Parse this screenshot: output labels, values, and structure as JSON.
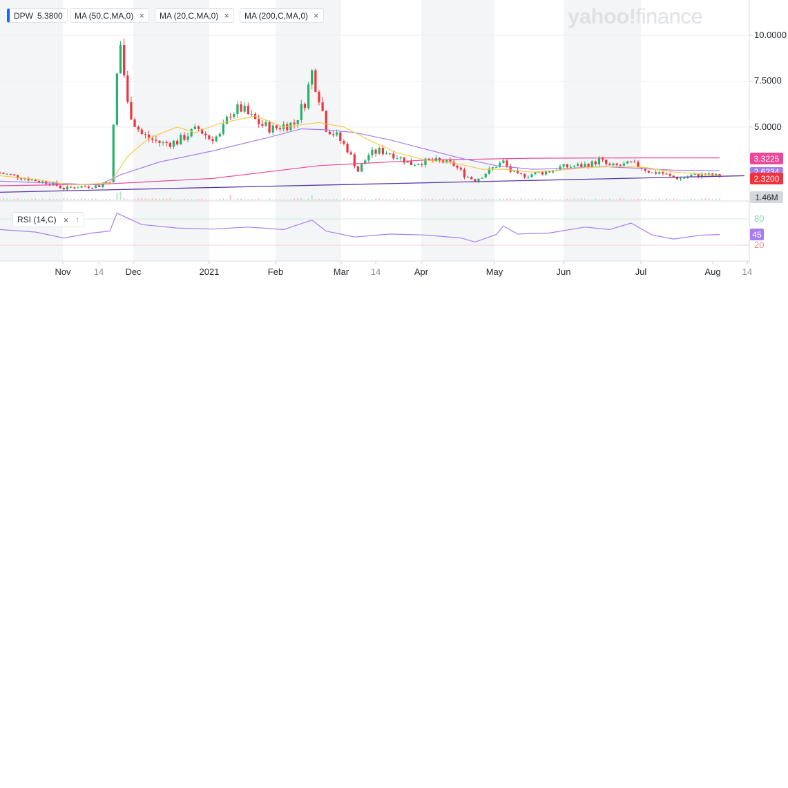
{
  "toolbar": {
    "ticker_label": "DPW",
    "ticker_value": "5.3800",
    "ma50_label": "MA (50,C,MA,0)",
    "ma20_label": "MA (20,C,MA,0)",
    "ma200_label": "MA (200,C,MA,0)",
    "close_glyph": "×"
  },
  "logo": {
    "text_bold": "yahoo!",
    "text_light": "finance"
  },
  "rsi": {
    "label": "RSI (14,C)",
    "close_glyph": "×",
    "expand_glyph": "↑",
    "upper": "80",
    "current": "45",
    "lower": "20"
  },
  "price_tags": {
    "ma200": {
      "text": "3.3225",
      "color": "#ec4899"
    },
    "ma50": {
      "text": "2.6234",
      "color": "#a77df2"
    },
    "last": {
      "text": "2.3200",
      "color": "#f0323c"
    },
    "volume": {
      "text": "1.46M",
      "color": "#b0b5bb"
    }
  },
  "colors": {
    "up": "#21b36a",
    "down": "#f0323c",
    "ma20": "#f7c948",
    "ma50": "#a77df2",
    "ma200": "#ec4899",
    "trend": "#5a34a8",
    "rsi": "#a77df2"
  },
  "chart_data": {
    "type": "candlestick",
    "y_ticks": [
      "10.0000",
      "7.5000",
      "5.0000"
    ],
    "x_ticks": [
      {
        "label": "Nov",
        "minor": false
      },
      {
        "label": "14",
        "minor": true
      },
      {
        "label": "Dec",
        "minor": false
      },
      {
        "label": "2021",
        "minor": false
      },
      {
        "label": "Feb",
        "minor": false
      },
      {
        "label": "Mar",
        "minor": false
      },
      {
        "label": "14",
        "minor": true
      },
      {
        "label": "Apr",
        "minor": false
      },
      {
        "label": "May",
        "minor": false
      },
      {
        "label": "Jun",
        "minor": false
      },
      {
        "label": "Jul",
        "minor": false
      },
      {
        "label": "Aug",
        "minor": false
      },
      {
        "label": "14",
        "minor": true
      }
    ],
    "ylim": [
      1.2,
      10.6
    ],
    "close_points": [
      [
        0,
        2.5
      ],
      [
        5,
        2.3
      ],
      [
        10,
        2.1
      ],
      [
        15,
        1.9
      ],
      [
        18,
        1.65
      ],
      [
        22,
        1.75
      ],
      [
        28,
        1.8
      ],
      [
        31,
        2.1
      ],
      [
        33,
        7.8
      ],
      [
        34,
        9.5
      ],
      [
        36,
        6.2
      ],
      [
        38,
        5.2
      ],
      [
        40,
        4.6
      ],
      [
        43,
        4.3
      ],
      [
        46,
        4.1
      ],
      [
        50,
        4.2
      ],
      [
        53,
        4.6
      ],
      [
        56,
        4.9
      ],
      [
        59,
        4.4
      ],
      [
        62,
        4.5
      ],
      [
        65,
        5.8
      ],
      [
        68,
        6.0
      ],
      [
        71,
        5.5
      ],
      [
        74,
        5.1
      ],
      [
        77,
        4.9
      ],
      [
        80,
        5.1
      ],
      [
        83,
        5.2
      ],
      [
        86,
        6.4
      ],
      [
        88,
        8.0
      ],
      [
        90,
        6.7
      ],
      [
        92,
        5.0
      ],
      [
        95,
        4.5
      ],
      [
        98,
        3.8
      ],
      [
        101,
        2.6
      ],
      [
        104,
        3.5
      ],
      [
        107,
        3.7
      ],
      [
        110,
        3.6
      ],
      [
        113,
        3.3
      ],
      [
        116,
        3.0
      ],
      [
        119,
        3.1
      ],
      [
        122,
        3.15
      ],
      [
        125,
        3.1
      ],
      [
        128,
        2.95
      ],
      [
        131,
        2.4
      ],
      [
        134,
        2.1
      ],
      [
        137,
        2.5
      ],
      [
        140,
        2.9
      ],
      [
        142,
        3.1
      ],
      [
        144,
        2.6
      ],
      [
        146,
        2.35
      ],
      [
        149,
        2.4
      ],
      [
        152,
        2.5
      ],
      [
        155,
        2.6
      ],
      [
        158,
        2.8
      ],
      [
        161,
        2.85
      ],
      [
        164,
        2.9
      ],
      [
        167,
        3.0
      ],
      [
        169,
        3.2
      ],
      [
        172,
        2.85
      ],
      [
        175,
        2.9
      ],
      [
        178,
        3.0
      ],
      [
        181,
        2.8
      ],
      [
        184,
        2.5
      ],
      [
        186,
        2.55
      ],
      [
        189,
        2.3
      ],
      [
        192,
        2.2
      ],
      [
        195,
        2.35
      ],
      [
        198,
        2.4
      ],
      [
        201,
        2.35
      ],
      [
        203,
        2.32
      ]
    ],
    "ma20_points": [
      [
        0,
        2.35
      ],
      [
        10,
        2.15
      ],
      [
        20,
        1.85
      ],
      [
        31,
        1.95
      ],
      [
        36,
        3.4
      ],
      [
        42,
        4.4
      ],
      [
        50,
        5.0
      ],
      [
        55,
        4.7
      ],
      [
        62,
        5.2
      ],
      [
        72,
        5.6
      ],
      [
        80,
        5.0
      ],
      [
        90,
        5.25
      ],
      [
        97,
        5.0
      ],
      [
        105,
        4.2
      ],
      [
        112,
        3.6
      ],
      [
        120,
        3.2
      ],
      [
        128,
        3.05
      ],
      [
        136,
        2.7
      ],
      [
        142,
        2.7
      ],
      [
        150,
        2.55
      ],
      [
        158,
        2.65
      ],
      [
        166,
        2.8
      ],
      [
        174,
        2.85
      ],
      [
        182,
        2.8
      ],
      [
        190,
        2.55
      ],
      [
        203,
        2.36
      ]
    ],
    "ma50_points": [
      [
        0,
        2.05
      ],
      [
        15,
        1.95
      ],
      [
        28,
        1.85
      ],
      [
        34,
        2.4
      ],
      [
        45,
        3.1
      ],
      [
        60,
        3.7
      ],
      [
        75,
        4.4
      ],
      [
        85,
        4.9
      ],
      [
        92,
        4.85
      ],
      [
        100,
        4.7
      ],
      [
        110,
        4.3
      ],
      [
        120,
        3.8
      ],
      [
        130,
        3.3
      ],
      [
        140,
        2.9
      ],
      [
        150,
        2.7
      ],
      [
        160,
        2.75
      ],
      [
        170,
        2.85
      ],
      [
        180,
        2.75
      ],
      [
        190,
        2.65
      ],
      [
        203,
        2.62
      ]
    ],
    "ma200_points": [
      [
        0,
        1.8
      ],
      [
        30,
        1.9
      ],
      [
        60,
        2.2
      ],
      [
        90,
        2.9
      ],
      [
        120,
        3.2
      ],
      [
        150,
        3.3
      ],
      [
        180,
        3.32
      ],
      [
        203,
        3.3225
      ]
    ],
    "trendline": [
      [
        0,
        1.45
      ],
      [
        210,
        2.35
      ]
    ],
    "rsi_points": [
      [
        0,
        55
      ],
      [
        10,
        50
      ],
      [
        18,
        38
      ],
      [
        26,
        48
      ],
      [
        31,
        52
      ],
      [
        33,
        88
      ],
      [
        36,
        78
      ],
      [
        40,
        65
      ],
      [
        50,
        58
      ],
      [
        60,
        56
      ],
      [
        70,
        60
      ],
      [
        80,
        55
      ],
      [
        88,
        74
      ],
      [
        92,
        52
      ],
      [
        100,
        40
      ],
      [
        110,
        46
      ],
      [
        120,
        44
      ],
      [
        130,
        38
      ],
      [
        134,
        30
      ],
      [
        140,
        45
      ],
      [
        142,
        62
      ],
      [
        146,
        46
      ],
      [
        155,
        48
      ],
      [
        165,
        60
      ],
      [
        172,
        55
      ],
      [
        178,
        68
      ],
      [
        184,
        44
      ],
      [
        190,
        36
      ],
      [
        198,
        44
      ],
      [
        203,
        45
      ]
    ]
  }
}
